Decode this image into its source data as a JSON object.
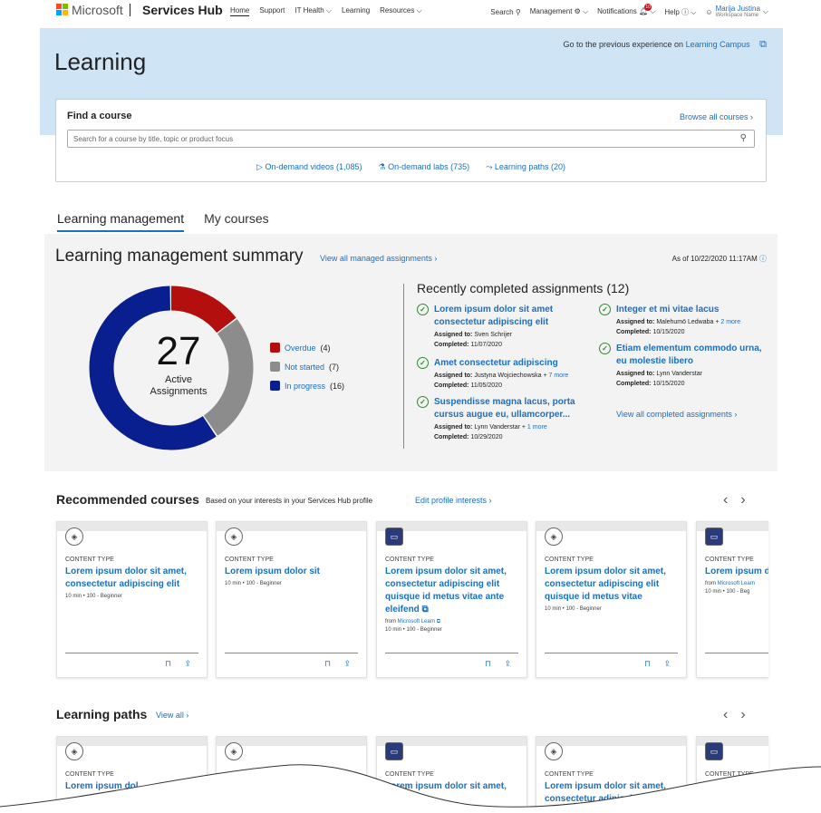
{
  "topnav": {
    "ms_word": "Microsoft",
    "brand": "Services Hub",
    "links": [
      {
        "label": "Home"
      },
      {
        "label": "Support"
      },
      {
        "label": "IT Health"
      },
      {
        "label": "Learning"
      },
      {
        "label": "Resources"
      }
    ],
    "search": "Search",
    "management": "Management",
    "notifications": "Notifications",
    "notif_count": "10",
    "help": "Help",
    "user_name": "Marija Justina",
    "user_sub": "Workspace Name"
  },
  "hero": {
    "title": "Learning",
    "prev_text": "Go to the previous experience on",
    "prev_link": "Learning Campus"
  },
  "find": {
    "title": "Find a course",
    "browse": "Browse all courses",
    "placeholder": "Search for a course by title, topic or product focus",
    "videos": "On-demand videos (1,085)",
    "labs": "On-demand labs (735)",
    "paths": "Learning paths (20)"
  },
  "tabs": [
    {
      "label": "Learning management"
    },
    {
      "label": "My courses"
    }
  ],
  "summary": {
    "title": "Learning management summary",
    "view_all": "View all managed assignments",
    "as_of": "As of 10/22/2020 11:17AM",
    "total": "27",
    "active_label": "Active",
    "assign_label": "Assignments",
    "legend": [
      {
        "label": "Overdue",
        "count": "(4)",
        "color": "#b40f0f",
        "value": 4
      },
      {
        "label": "Not started",
        "count": "(7)",
        "color": "#8c8c8c",
        "value": 7
      },
      {
        "label": "In progress",
        "count": "(16)",
        "color": "#0a1f8f",
        "value": 16
      }
    ],
    "recent_title": "Recently completed assignments",
    "recent_count": "(12)",
    "assigned_lbl": "Assigned to:",
    "completed_lbl": "Completed:",
    "items": [
      {
        "title": "Lorem ipsum dolor sit amet consectetur adipiscing elit",
        "assigned": "Sven Schrijer",
        "more": "",
        "completed": "11/07/2020"
      },
      {
        "title": "Amet consectetur adipiscing",
        "assigned": "Justyna Wojciechowska +",
        "more": "7 more",
        "completed": "11/05/2020"
      },
      {
        "title": "Suspendisse magna lacus, porta cursus augue eu, ullamcorper...",
        "assigned": "Lynn Vanderstar +",
        "more": "1 more",
        "completed": "10/29/2020"
      },
      {
        "title": "Integer et mi vitae lacus",
        "assigned": "Malehumö Ledwaba +",
        "more": "2 more",
        "completed": "10/15/2020"
      },
      {
        "title": "Etiam elementum commodo urna, eu molestie libero",
        "assigned": "Lynn Vanderstar",
        "more": "",
        "completed": "10/15/2020"
      }
    ],
    "view_completed": "View all completed assignments"
  },
  "recommended": {
    "title": "Recommended courses",
    "sub": "Based on your interests in your Services Hub profile",
    "edit": "Edit profile interests",
    "cards": [
      {
        "type": "CONTENT TYPE",
        "title": "Lorem ipsum dolor sit amet, consectetur adipiscing elit",
        "from": "",
        "from_link": "",
        "meta": "10 min  •  100 - Beginner"
      },
      {
        "type": "CONTENT TYPE",
        "title": "Lorem ipsum dolor sit",
        "from": "",
        "from_link": "",
        "meta": "10 min  •  100 - Beginner"
      },
      {
        "type": "CONTENT TYPE",
        "title": "Lorem ipsum dolor sit amet, consectetur adipiscing elit quisque id metus vitae ante eleifend ⧉",
        "from": "from",
        "from_link": "Microsoft Learn ⧉",
        "meta": "10 min  •  100 - Beginner"
      },
      {
        "type": "CONTENT TYPE",
        "title": "Lorem ipsum dolor sit amet, consectetur adipiscing elit quisque id metus vitae",
        "from": "",
        "from_link": "",
        "meta": "10 min  •  100 - Beginner"
      },
      {
        "type": "CONTENT TYPE",
        "title": "Lorem ipsum d",
        "from": "from",
        "from_link": "Microsoft Learn",
        "meta": "10 min  •  100 - Beg"
      }
    ]
  },
  "paths": {
    "title": "Learning paths",
    "view_all": "View all",
    "cards": [
      {
        "type": "CONTENT TYPE",
        "title": "Lorem ipsum dol"
      },
      {
        "type": "",
        "title": ""
      },
      {
        "type": "CONTENT TYPE",
        "title": "Lorem ipsum dolor sit amet,"
      },
      {
        "type": "CONTENT TYPE",
        "title": "Lorem ipsum dolor sit amet, consectetur adipiscing elit"
      },
      {
        "type": "CONTENT TYPE",
        "title": ""
      }
    ]
  }
}
